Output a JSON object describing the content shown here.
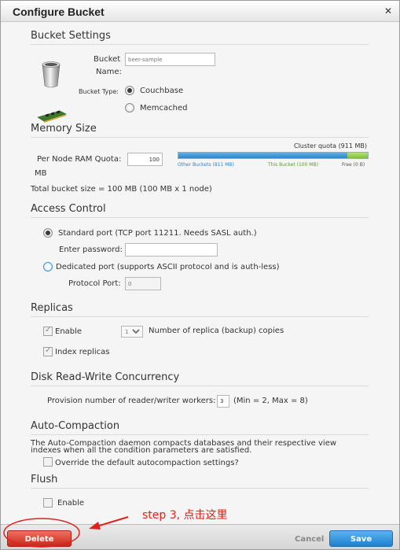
{
  "dialog": {
    "title": "Configure Bucket"
  },
  "bucket_settings": {
    "heading": "Bucket Settings",
    "bucket_label": "Bucket Name:",
    "bucket_label_line1": "Bucket",
    "bucket_label_line2": "Name:",
    "bucket_value": "beer-sample",
    "type_label": "Bucket Type:",
    "type_options": [
      "Couchbase",
      "Memcached"
    ],
    "selected_type": "Couchbase"
  },
  "memory": {
    "heading": "Memory Size",
    "quota_label": "Per Node RAM Quota:",
    "quota_value": "100",
    "quota_unit": "MB",
    "cluster_quota": "Cluster quota (911 MB)",
    "legend_other": "Other Buckets (811 MB)",
    "legend_this": "This Bucket (100 MB)",
    "legend_free": "Free (0 B)",
    "other_mb": 811,
    "this_mb": 100,
    "free_mb": 0,
    "total_mb": 911,
    "total_text": "Total bucket size = 100 MB (100 MB x 1 node)",
    "colors": {
      "other": "#2c86c9",
      "this": "#7fbf3e"
    }
  },
  "access": {
    "heading": "Access Control",
    "standard": "Standard port (TCP port 11211. Needs SASL auth.)",
    "password_label": "Enter password:",
    "password_value": "",
    "dedicated": "Dedicated port (supports ASCII protocol and is auth-less)",
    "port_label": "Protocol Port:",
    "port_placeholder": "0"
  },
  "replicas": {
    "heading": "Replicas",
    "enable": "Enable",
    "count": "1",
    "count_label": "Number of replica (backup) copies",
    "index": "Index replicas"
  },
  "concurrency": {
    "heading": "Disk Read-Write Concurrency",
    "label": "Provision number of reader/writer workers:",
    "value": "3",
    "range": "(Min = 2, Max = 8)"
  },
  "compaction": {
    "heading": "Auto-Compaction",
    "description_line1": "The Auto-Compaction daemon compacts databases and their respective view",
    "description_line2": "indexes when all the condition parameters are satisfied.",
    "override": "Override the default autocompaction settings?"
  },
  "flush": {
    "heading": "Flush",
    "enable": "Enable"
  },
  "footer": {
    "delete": "Delete",
    "cancel": "Cancel",
    "save": "Save"
  },
  "annotation": {
    "text": "step 3, 点击这里",
    "color": "#e0211d"
  },
  "icons": {
    "bucket": "bucket-icon",
    "memory": "memory-chip-icon",
    "close": "close-icon"
  }
}
